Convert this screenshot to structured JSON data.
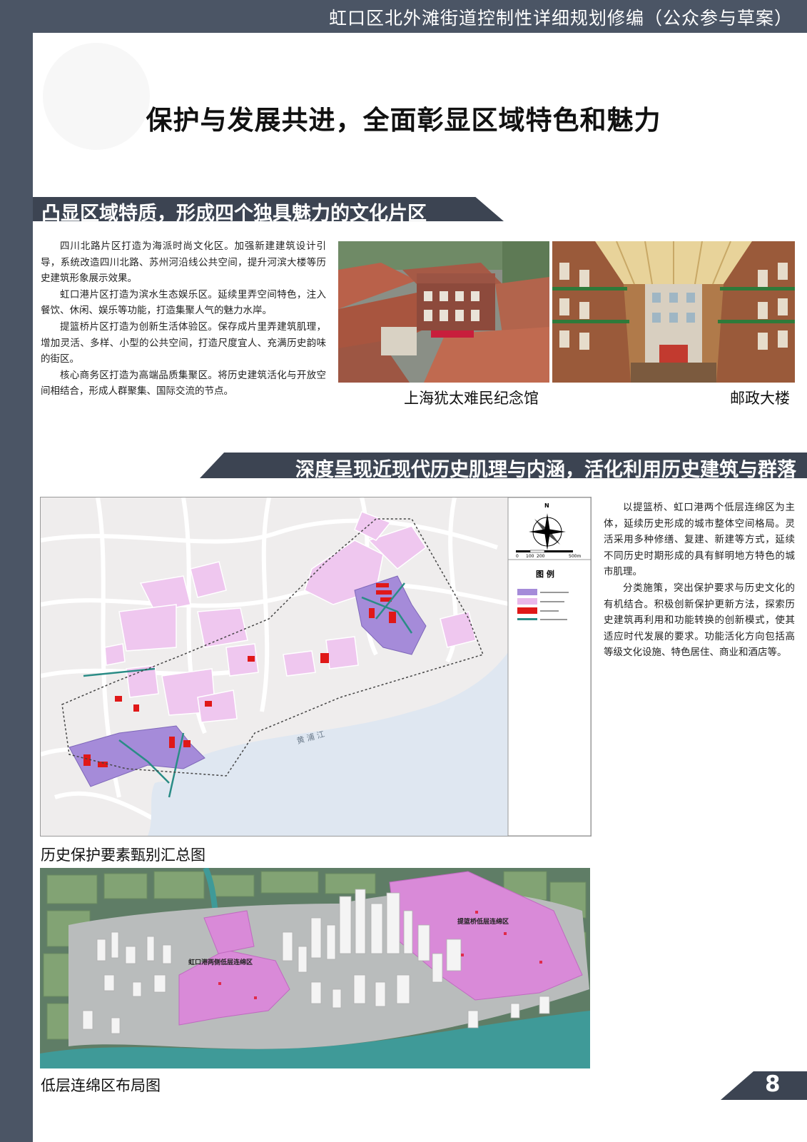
{
  "header": {
    "title": "虹口区北外滩街道控制性详细规划修编（公众参与草案）"
  },
  "main_title": "保护与发展共进，全面彰显区域特色和魅力",
  "section1": {
    "heading": "凸显区域特质，形成四个独具魅力的文化片区",
    "paragraphs": [
      "四川北路片区打造为海派时尚文化区。加强新建建筑设计引导，系统改造四川北路、苏州河沿线公共空间，提升河滨大楼等历史建筑形象展示效果。",
      "虹口港片区打造为滨水生态娱乐区。延续里弄空间特色，注入餐饮、休闲、娱乐等功能，打造集聚人气的魅力水岸。",
      "提篮桥片区打造为创新生活体验区。保存成片里弄建筑肌理，增加灵活、多样、小型的公共空间，打造尺度宜人、充满历史韵味的街区。",
      "核心商务区打造为高端品质集聚区。将历史建筑活化与开放空间相结合，形成人群聚集、国际交流的节点。"
    ],
    "photos": [
      {
        "caption": "上海犹太难民纪念馆"
      },
      {
        "caption": "邮政大楼"
      }
    ]
  },
  "section2": {
    "heading": "深度呈现近现代历史肌理与内涵，活化利用历史建筑与群落",
    "paragraphs": [
      "以提篮桥、虹口港两个低层连绵区为主体，延续历史形成的城市整体空间格局。灵活采用多种修缮、复建、新建等方式，延续不同历史时期形成的具有鲜明地方特色的城市肌理。",
      "分类施策，突出保护要求与历史文化的有机结合。积极创新保护更新方法，探索历史建筑再利用和功能转换的创新模式，使其适应时代发展的要求。功能活化方向包括高等级文化设施、特色居住、商业和酒店等。"
    ],
    "map1": {
      "caption": "历史保护要素甄别汇总图",
      "north": "N",
      "scale": [
        "0",
        "100",
        "200",
        "500m"
      ],
      "legend_title": "图 例",
      "river_label": "黄 浦 江",
      "colors": {
        "zone": "#a58bd9",
        "area": "#e8b8ea",
        "building": "#e01818",
        "path": "#2a8c86"
      }
    },
    "map2": {
      "caption": "低层连绵区布局图",
      "labels": [
        "提篮桥低层连绵区",
        "虹口港两侧低层连绵区"
      ]
    }
  },
  "page_number": "8"
}
